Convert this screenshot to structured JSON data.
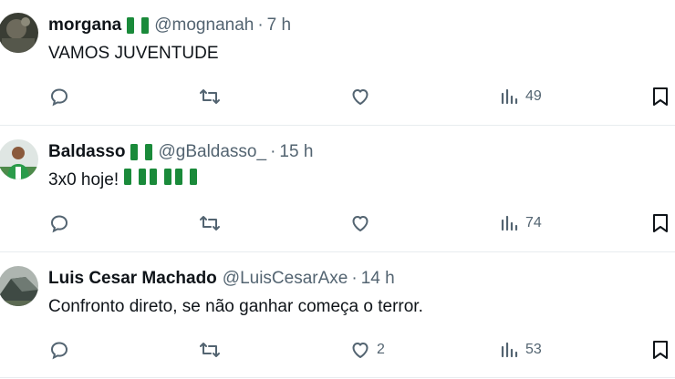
{
  "tweets": [
    {
      "name": "morgana",
      "handle": "@mognanah",
      "separator": "·",
      "time": "7 h",
      "text": "VAMOS JUVENTUDE",
      "text_flags": 0,
      "name_flag": true,
      "avatar": "avatar-dark-photo",
      "replies": "",
      "retweets": "",
      "likes": "",
      "views": "49"
    },
    {
      "name": "Baldasso",
      "handle": "@gBaldasso_",
      "separator": "·",
      "time": "15 h",
      "text": "3x0 hoje!",
      "text_flags": 3,
      "name_flag": true,
      "avatar": "avatar-football-player",
      "replies": "",
      "retweets": "",
      "likes": "",
      "views": "74"
    },
    {
      "name": "Luis Cesar Machado",
      "handle": "@LuisCesarAxe",
      "separator": "·",
      "time": "14 h",
      "text": "Confronto direto, se não ganhar começa o terror.",
      "text_flags": 0,
      "name_flag": false,
      "avatar": "avatar-tent-photo",
      "replies": "",
      "retweets": "",
      "likes": "2",
      "views": "53"
    }
  ],
  "icons": {
    "reply": "reply-icon",
    "retweet": "retweet-icon",
    "like": "heart-icon",
    "views": "views-chart-icon",
    "bookmark": "bookmark-icon",
    "flag": "green-white-green-flag-icon"
  },
  "colors": {
    "text": "#0f1419",
    "muted": "#536471",
    "divider": "#e8ecef",
    "flag_green": "#1a8a3a"
  }
}
